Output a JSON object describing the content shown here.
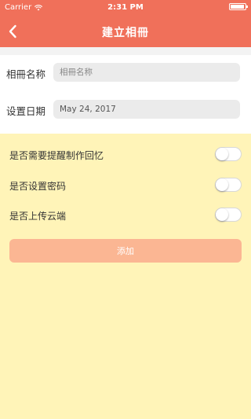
{
  "status_bar": {
    "carrier": "Carrier",
    "time": "2:31 PM"
  },
  "nav": {
    "title": "建立相冊",
    "back_icon": "chevron-left-icon"
  },
  "form": {
    "name_label": "相冊名称",
    "name_placeholder": "相冊名称",
    "name_value": "",
    "date_label": "设置日期",
    "date_value": "May 24, 2017"
  },
  "options": [
    {
      "label": "是否需要提醒制作回忆",
      "enabled": false
    },
    {
      "label": "是否设置密码",
      "enabled": false
    },
    {
      "label": "是否上传云端",
      "enabled": false
    }
  ],
  "add_button": {
    "label": "添加"
  },
  "colors": {
    "brand": "#f0705a",
    "panel": "#fff4b8",
    "button": "#fbb693"
  }
}
